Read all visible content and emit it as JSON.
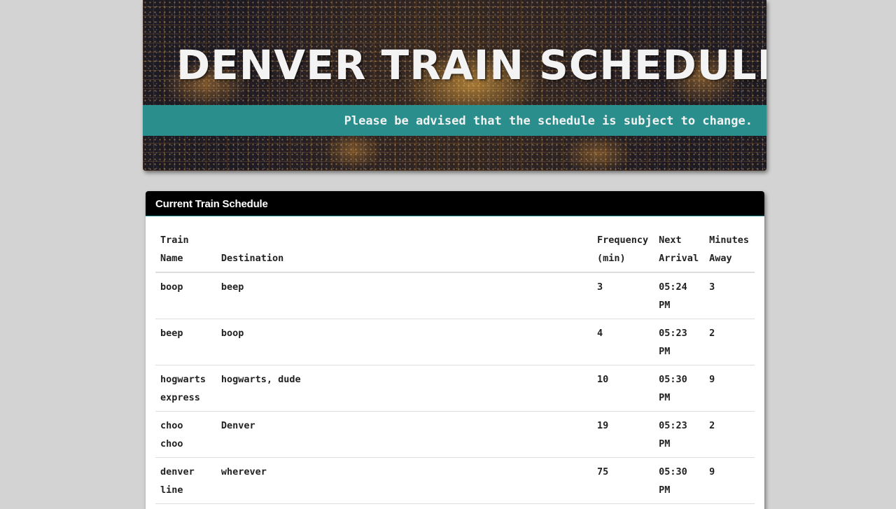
{
  "banner": {
    "title": "DENVER TRAIN SCHEDULE",
    "advisory": "Please be advised that the schedule is subject to change."
  },
  "schedule_panel": {
    "title": "Current Train Schedule",
    "columns": {
      "name": [
        "Train",
        "Name"
      ],
      "destination": [
        "",
        "Destination"
      ],
      "frequency": [
        "Frequency",
        "(min)"
      ],
      "next": [
        "Next",
        "Arrival"
      ],
      "minutes": [
        "Minutes",
        "Away"
      ]
    },
    "rows": [
      {
        "name": [
          "boop"
        ],
        "destination": "beep",
        "frequency": "3",
        "next": [
          "05:24",
          "PM"
        ],
        "minutes": "3"
      },
      {
        "name": [
          "beep"
        ],
        "destination": "boop",
        "frequency": "4",
        "next": [
          "05:23",
          "PM"
        ],
        "minutes": "2"
      },
      {
        "name": [
          "hogwarts",
          "express"
        ],
        "destination": "hogwarts, dude",
        "frequency": "10",
        "next": [
          "05:30",
          "PM"
        ],
        "minutes": "9"
      },
      {
        "name": [
          "choo choo"
        ],
        "destination": "Denver",
        "frequency": "19",
        "next": [
          "05:23",
          "PM"
        ],
        "minutes": "2"
      },
      {
        "name": [
          "denver",
          "line"
        ],
        "destination": "wherever",
        "frequency": "75",
        "next": [
          "05:30",
          "PM"
        ],
        "minutes": "9"
      }
    ]
  },
  "colors": {
    "page_background": "#d3d3d3",
    "advisory_bar": "#2a8f8c",
    "panel_heading": "#000000",
    "text": "#222222"
  }
}
